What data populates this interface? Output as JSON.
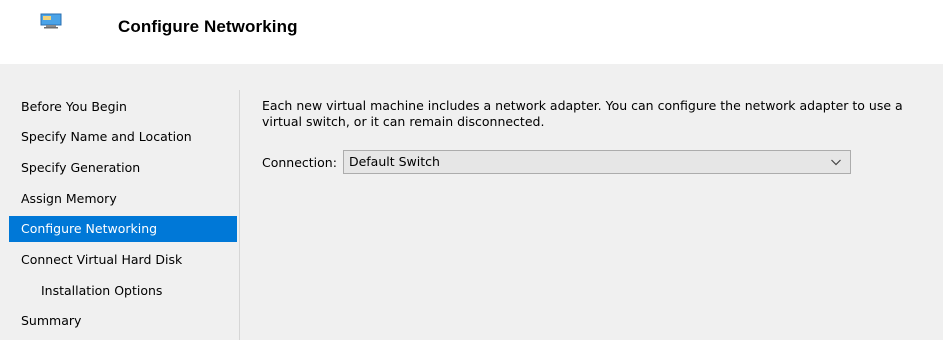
{
  "header": {
    "title": "Configure Networking",
    "icon": "wizard-monitor-icon"
  },
  "steps": [
    {
      "label": "Before You Begin",
      "active": false,
      "sub": false
    },
    {
      "label": "Specify Name and Location",
      "active": false,
      "sub": false
    },
    {
      "label": "Specify Generation",
      "active": false,
      "sub": false
    },
    {
      "label": "Assign Memory",
      "active": false,
      "sub": false
    },
    {
      "label": "Configure Networking",
      "active": true,
      "sub": false
    },
    {
      "label": "Connect Virtual Hard Disk",
      "active": false,
      "sub": false
    },
    {
      "label": "Installation Options",
      "active": false,
      "sub": true
    },
    {
      "label": "Summary",
      "active": false,
      "sub": false
    }
  ],
  "main": {
    "description": "Each new virtual machine includes a network adapter. You can configure the network adapter to use a virtual switch, or it can remain disconnected.",
    "connection_label": "Connection:",
    "connection_value": "Default Switch"
  },
  "colors": {
    "accent": "#0078d7",
    "background": "#f0f0f0",
    "header_background": "#ffffff"
  }
}
